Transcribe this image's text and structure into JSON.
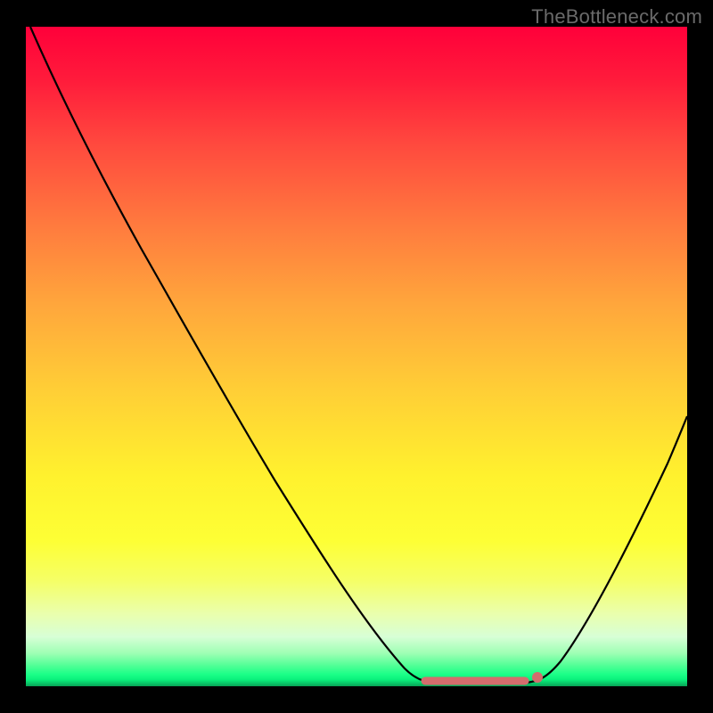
{
  "watermark": "TheBottleneck.com",
  "chart_data": {
    "type": "line",
    "title": "",
    "xlabel": "",
    "ylabel": "",
    "xlim": [
      0,
      100
    ],
    "ylim": [
      0,
      100
    ],
    "x": [
      0,
      5,
      10,
      15,
      20,
      25,
      30,
      35,
      40,
      45,
      50,
      55,
      58,
      62,
      66,
      70,
      74,
      78,
      82,
      86,
      90,
      94,
      98,
      100
    ],
    "values": [
      100,
      94,
      85,
      76,
      67,
      58,
      49,
      40,
      31,
      22,
      14,
      7,
      3,
      1,
      0,
      0,
      0,
      1,
      4,
      10,
      19,
      29,
      40,
      46
    ],
    "flat_segment": {
      "x_start": 62,
      "x_end": 76,
      "y": 0.5
    },
    "marker": {
      "x": 77,
      "y": 1.2,
      "color": "#d46d6d"
    },
    "gradient_stops": [
      {
        "pos": 0.0,
        "color": "#ff003a"
      },
      {
        "pos": 0.5,
        "color": "#ffce36"
      },
      {
        "pos": 0.8,
        "color": "#fdff35"
      },
      {
        "pos": 0.95,
        "color": "#9effb4"
      },
      {
        "pos": 1.0,
        "color": "#08a356"
      }
    ]
  }
}
